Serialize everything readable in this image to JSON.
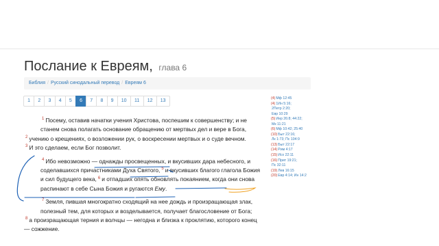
{
  "header": {
    "title": "Послание к Евреям,",
    "subtitle": "глава 6"
  },
  "breadcrumb": {
    "items": [
      "Библия",
      "Русский синодальный перевод",
      "Евреям 6"
    ]
  },
  "pager": {
    "pages": [
      "1",
      "2",
      "3",
      "4",
      "5",
      "6",
      "7",
      "8",
      "9",
      "10",
      "11",
      "12",
      "13"
    ],
    "active": "6"
  },
  "verses": [
    {
      "num": "1",
      "text": "Посему, оставив начатки учения Христова, поспешим к совершенству; и не станем снова полагать основание обращению от мертвых дел и вере в Бога,"
    },
    {
      "num": "2",
      "text": "учению о крещениях, о возложении рук, о воскресении мертвых и о суде вечном."
    },
    {
      "num": "3",
      "text": "И это сделаем, если Бог позволит."
    },
    {
      "num": "4",
      "text": "Ибо невозможно — однажды просвещенных, и вкусивших дара небесного, и соделавшихся причастниками Духа Святого,"
    },
    {
      "num": "5",
      "text": "и вкусивших благого глагола Божия и сил будущего века,"
    },
    {
      "num": "6",
      "text": "и отпадших опять обновлять покаянием, когда они снова распинают в себе Сына Божия и ругаются",
      "emph": "Ему",
      "end": "."
    },
    {
      "num": "7",
      "text": "Земля, пившая многократно сходящий на нее дождь и произращающая злак, полезный тем, для которых и возделывается, получает благословение от Бога;"
    },
    {
      "num": "8",
      "text": "а произращающая терния и волчцы — негодна и близка к проклятию, которого конец — сожжение."
    }
  ],
  "cross_refs": [
    {
      "num": "(4)",
      "text": "Мф 12:45"
    },
    {
      "num": "(4)",
      "text": "1Ин 5:16;"
    },
    {
      "num": "",
      "text": "2Петр 2:20;"
    },
    {
      "num": "",
      "text": "Евр 10:29"
    },
    {
      "num": "(5)",
      "text": "Иер 26:8; 44:22;"
    },
    {
      "num": "",
      "text": "Мк 11:21"
    },
    {
      "num": "(6)",
      "text": "Мф 10:42; 25:40"
    },
    {
      "num": "(10)",
      "text": "Быт 22:16;"
    },
    {
      "num": "",
      "text": "Лк 1:73; Пс 104:9"
    },
    {
      "num": "(13)",
      "text": "Быт 22:17"
    },
    {
      "num": "(14)",
      "text": "Рим 4:17"
    },
    {
      "num": "(15)",
      "text": "Исх 22:11"
    },
    {
      "num": "(16)",
      "text": "Прит 19:21;"
    },
    {
      "num": "",
      "text": "Пс 32:11"
    },
    {
      "num": "(19)",
      "text": "Лев 16:15"
    },
    {
      "num": "(20)",
      "text": "Евр 4:14; Ин 14:2"
    }
  ],
  "colors": {
    "link": "#337ab7",
    "verse_number": "#c0392b",
    "active_page": "#337ab7",
    "ink_blue": "#1a5fb4",
    "ink_orange": "#f0a020"
  }
}
